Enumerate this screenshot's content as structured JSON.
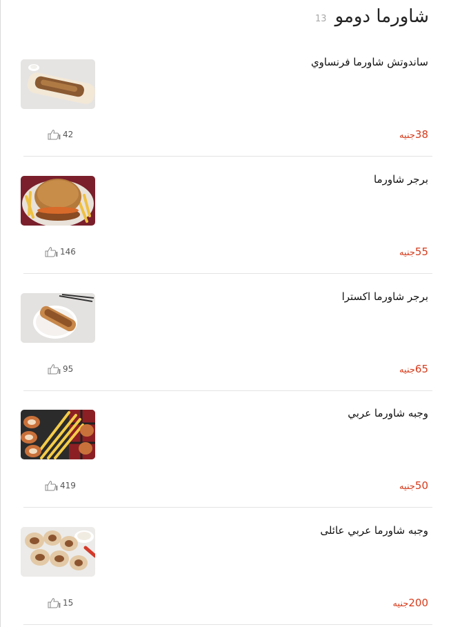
{
  "menu": {
    "section_title": "شاورما دومو",
    "section_count": "13",
    "currency": "جنيه",
    "items": [
      {
        "name": "ساندوتش شاورما فرنساوي",
        "price": "38",
        "likes": "42"
      },
      {
        "name": "برجر شاورما",
        "price": "55",
        "likes": "146"
      },
      {
        "name": "برجر شاورما اكسترا",
        "price": "65",
        "likes": "95"
      },
      {
        "name": "وجبه شاورما عربي",
        "price": "50",
        "likes": "419"
      },
      {
        "name": "وجبه شاورما عربي عائلى",
        "price": "200",
        "likes": "15"
      }
    ]
  },
  "colors": {
    "price": "#d63a1a",
    "count": "#a9a9a9",
    "divider": "#e3e3e3"
  },
  "icons": {
    "like": "thumbs-up-icon"
  }
}
